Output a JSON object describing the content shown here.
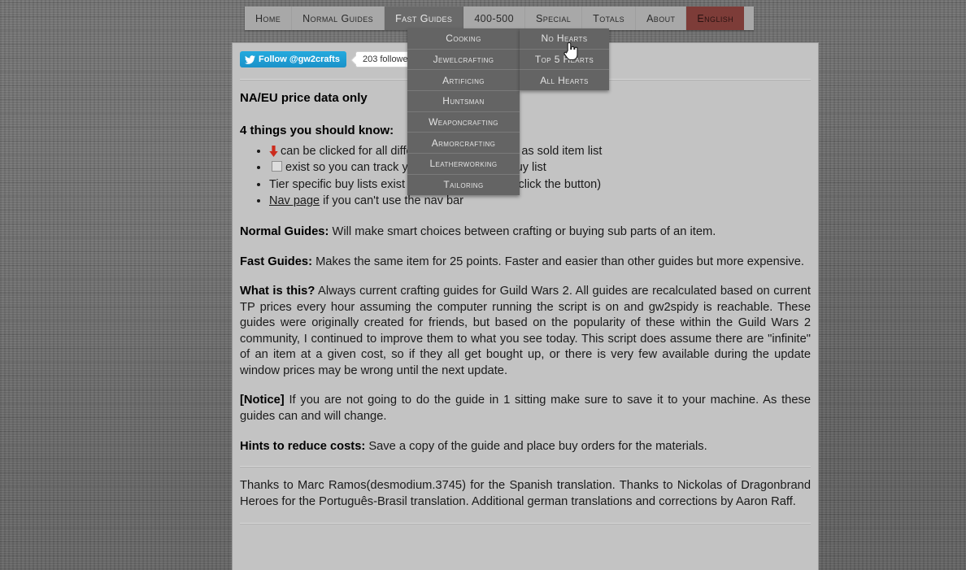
{
  "nav": {
    "items": [
      {
        "label": "Home",
        "state": "normal",
        "name": "nav-home"
      },
      {
        "label": "Normal Guides",
        "state": "normal",
        "name": "nav-normal-guides"
      },
      {
        "label": "Fast Guides",
        "state": "active",
        "name": "nav-fast-guides"
      },
      {
        "label": "400-500",
        "state": "plain",
        "name": "nav-400-500"
      },
      {
        "label": "Special",
        "state": "normal",
        "name": "nav-special"
      },
      {
        "label": "Totals",
        "state": "normal",
        "name": "nav-totals"
      },
      {
        "label": "About",
        "state": "normal",
        "name": "nav-about"
      },
      {
        "label": "English",
        "state": "lang",
        "name": "nav-english"
      }
    ],
    "accent_language_color": "#7d3c38",
    "active_color": "#6a6a6a",
    "bar_color": "#a8a8a8"
  },
  "dropdowns": {
    "fast_guides": {
      "items": [
        "Cooking",
        "Jewelcrafting",
        "Artificing",
        "Huntsman",
        "Weaponcrafting",
        "Armorcrafting",
        "Leatherworking",
        "Tailoring"
      ]
    },
    "hearts": {
      "items": [
        "No Hearts",
        "Top 5 Hearts",
        "All Hearts"
      ],
      "hovered": "No Hearts"
    }
  },
  "twitter": {
    "follow_label": "Follow @gw2crafts",
    "followers_label": "203 followers",
    "bird_icon": "twitter-bird-icon",
    "brand_color": "#1b92c9"
  },
  "content": {
    "price_notice": "NA/EU price data only",
    "facts_heading": "4 things you should know:",
    "facts": [
      {
        "icon": "red-down-arrow-icon",
        "text": "can be clicked for all different buy lists as well as sold item list"
      },
      {
        "icon": "checkbox-icon",
        "text": "exist so you can track your progress in the buy list"
      },
      {
        "icon": "none",
        "text": "Tier specific buy lists exist for all normal guides(click the button)"
      },
      {
        "icon": "none",
        "link": "Nav page",
        "text": "if you can't use the nav bar"
      }
    ],
    "paragraphs": [
      {
        "lead": "Normal Guides:",
        "body": "Will make smart choices between crafting or buying sub parts of an item."
      },
      {
        "lead": "Fast Guides:",
        "body": "Makes the same item for 25 points. Faster and easier than other guides but more expensive."
      },
      {
        "lead": "What is this?",
        "body": "Always current crafting guides for Guild Wars 2. All guides are recalculated based on current TP prices every hour assuming the computer running the script is on and gw2spidy is reachable. These guides were originally created for friends, but based on the popularity of these within the Guild Wars 2 community, I continued to improve them to what you see today. This script does assume there are \"infinite\" of an item at a given cost, so if they all get bought up, or there is very few available during the update window prices may be wrong until the next update."
      },
      {
        "lead": "[Notice]",
        "body": "If you are not going to do the guide in 1 sitting make sure to save it to your machine. As these guides can and will change."
      },
      {
        "lead": "Hints to reduce costs:",
        "body": "Save a copy of the guide and place buy orders for the materials."
      }
    ],
    "thanks": "Thanks to Marc Ramos(desmodium.3745) for the Spanish translation. Thanks to Nickolas of Dragonbrand Heroes for the Português-Brasil translation. Additional german translations and corrections by Aaron Raff."
  },
  "cursor": {
    "type": "pointing-hand-cursor"
  }
}
